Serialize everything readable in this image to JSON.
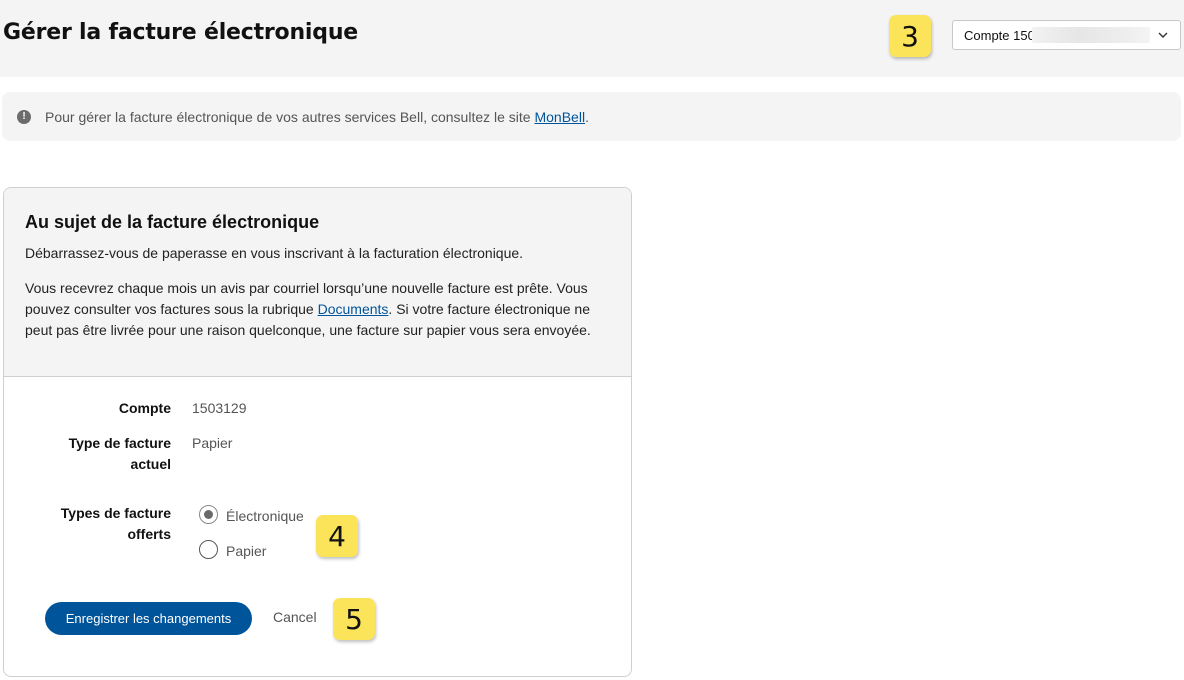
{
  "header": {
    "title": "Gérer la facture électronique",
    "account_select": {
      "label": "Compte 150"
    }
  },
  "callouts": {
    "three": "3",
    "four": "4",
    "five": "5"
  },
  "info_banner": {
    "icon": "!",
    "text": "Pour gérer la facture électronique de vos autres services Bell, consultez le site ",
    "link": "MonBell",
    "suffix": "."
  },
  "card": {
    "title": "Au sujet de la facture électronique",
    "intro": "Débarrassez-vous de paperasse en vous inscrivant à la facturation électronique.",
    "body_part1": "Vous recevrez chaque mois un avis par courriel lorsqu’une nouvelle facture est prête. Vous pouvez consulter vos factures sous la rubrique ",
    "body_link": "Documents",
    "body_part2": ". Si votre facture électronique ne peut pas être livrée pour une raison quelconque, une facture sur papier vous sera envoyée."
  },
  "form": {
    "account_label": "Compte",
    "account_value": "1503129",
    "current_type_label_line1": "Type de facture",
    "current_type_label_line2": "actuel",
    "current_type_value": "Papier",
    "offered_label_line1": "Types de facture",
    "offered_label_line2": "offerts",
    "options": [
      {
        "label": "Électronique",
        "selected": true
      },
      {
        "label": "Papier",
        "selected": false
      }
    ],
    "save_label": "Enregistrer les changements",
    "cancel_label": "Cancel"
  },
  "colors": {
    "brand_blue": "#00549a",
    "callout_yellow": "#fbe45a",
    "panel_gray": "#f4f4f4"
  },
  "icons": [
    "alert-info-icon",
    "chevron-down-icon"
  ]
}
